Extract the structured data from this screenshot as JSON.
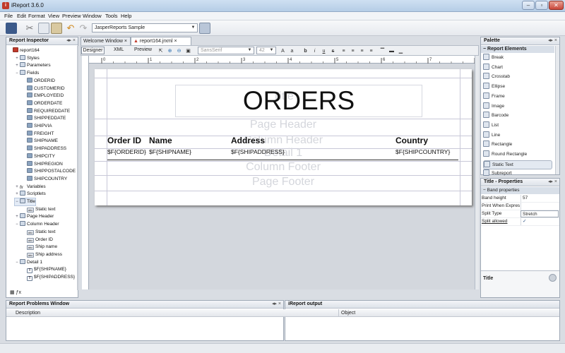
{
  "window": {
    "title": "iReport 3.6.0"
  },
  "menu": [
    "File",
    "Edit",
    "Format",
    "View",
    "Preview",
    "Window",
    "Tools",
    "Help"
  ],
  "toolbar": {
    "datasource": "JasperReports Sample"
  },
  "inspector": {
    "title": "Report Inspector",
    "nodes": [
      {
        "label": "report164",
        "depth": 0,
        "icon": "doc"
      },
      {
        "label": "Styles",
        "depth": 1,
        "icon": "folder",
        "exp": "+"
      },
      {
        "label": "Parameters",
        "depth": 1,
        "icon": "folder",
        "exp": "+"
      },
      {
        "label": "Fields",
        "depth": 1,
        "icon": "folder",
        "exp": "−"
      },
      {
        "label": "ORDERID",
        "depth": 2,
        "icon": "fld"
      },
      {
        "label": "CUSTOMERID",
        "depth": 2,
        "icon": "fld"
      },
      {
        "label": "EMPLOYEEID",
        "depth": 2,
        "icon": "fld"
      },
      {
        "label": "ORDERDATE",
        "depth": 2,
        "icon": "fld"
      },
      {
        "label": "REQUIREDDATE",
        "depth": 2,
        "icon": "fld"
      },
      {
        "label": "SHIPPEDDATE",
        "depth": 2,
        "icon": "fld"
      },
      {
        "label": "SHIPVIA",
        "depth": 2,
        "icon": "fld"
      },
      {
        "label": "FREIGHT",
        "depth": 2,
        "icon": "fld"
      },
      {
        "label": "SHIPNAME",
        "depth": 2,
        "icon": "fld"
      },
      {
        "label": "SHIPADDRESS",
        "depth": 2,
        "icon": "fld"
      },
      {
        "label": "SHIPCITY",
        "depth": 2,
        "icon": "fld"
      },
      {
        "label": "SHIPREGION",
        "depth": 2,
        "icon": "fld"
      },
      {
        "label": "SHIPPOSTALCODE",
        "depth": 2,
        "icon": "fld"
      },
      {
        "label": "SHIPCOUNTRY",
        "depth": 2,
        "icon": "fld"
      },
      {
        "label": "Variables",
        "depth": 1,
        "icon": "fx",
        "exp": "+"
      },
      {
        "label": "Scriptlets",
        "depth": 1,
        "icon": "folder",
        "exp": "+"
      },
      {
        "label": "Title",
        "depth": 1,
        "icon": "band",
        "exp": "−",
        "selected": true
      },
      {
        "label": "Static text",
        "depth": 2,
        "icon": "abc"
      },
      {
        "label": "Page Header",
        "depth": 1,
        "icon": "band",
        "exp": "+"
      },
      {
        "label": "Column Header",
        "depth": 1,
        "icon": "band",
        "exp": "−"
      },
      {
        "label": "Static text",
        "depth": 2,
        "icon": "abc"
      },
      {
        "label": "Order ID",
        "depth": 2,
        "icon": "abc"
      },
      {
        "label": "Ship name",
        "depth": 2,
        "icon": "abc"
      },
      {
        "label": "Ship address",
        "depth": 2,
        "icon": "abc"
      },
      {
        "label": "Detail 1",
        "depth": 1,
        "icon": "band",
        "exp": "−"
      },
      {
        "label": "$F{SHIPNAME}",
        "depth": 2,
        "icon": "txt"
      },
      {
        "label": "$F{SHIPADDRESS}",
        "depth": 2,
        "icon": "txt"
      }
    ]
  },
  "tabs": [
    {
      "label": "Welcome Window"
    },
    {
      "label": "report164.jrxml"
    }
  ],
  "designer": {
    "views": [
      "Designer",
      "XML",
      "Preview"
    ],
    "font": "SansSerif",
    "size": "42"
  },
  "report": {
    "title": "ORDERS",
    "headers": [
      "Order ID",
      "Name",
      "Address",
      "Country"
    ],
    "fields": [
      "$F{ORDERID}",
      "$F{SHIPNAME}",
      "$F{SHIPADDRESS}",
      "$F{SHIPCOUNTRY}"
    ],
    "bands": [
      "Title",
      "Page Header",
      "Column Header",
      "Detail 1",
      "Column Footer",
      "Page Footer"
    ]
  },
  "palette": {
    "title": "Palette",
    "section": "Report Elements",
    "items": [
      "Break",
      "Chart",
      "Crosstab",
      "Ellipse",
      "Frame",
      "Image",
      "Barcode",
      "List",
      "Line",
      "Rectangle",
      "Round Rectangle",
      "Static Text",
      "Subreport"
    ]
  },
  "properties": {
    "title": "Title - Properties",
    "section": "Band properties",
    "rows": [
      {
        "label": "Band height",
        "value": "57"
      },
      {
        "label": "Print When Expression",
        "value": ""
      },
      {
        "label": "Split Type",
        "value": "Stretch"
      },
      {
        "label": "Split allowed",
        "value": "✓"
      }
    ],
    "footer": "Title"
  },
  "problems": {
    "title": "Report Problems Window",
    "columns": [
      "Description",
      "Object"
    ]
  },
  "output": {
    "title": "iReport output"
  }
}
